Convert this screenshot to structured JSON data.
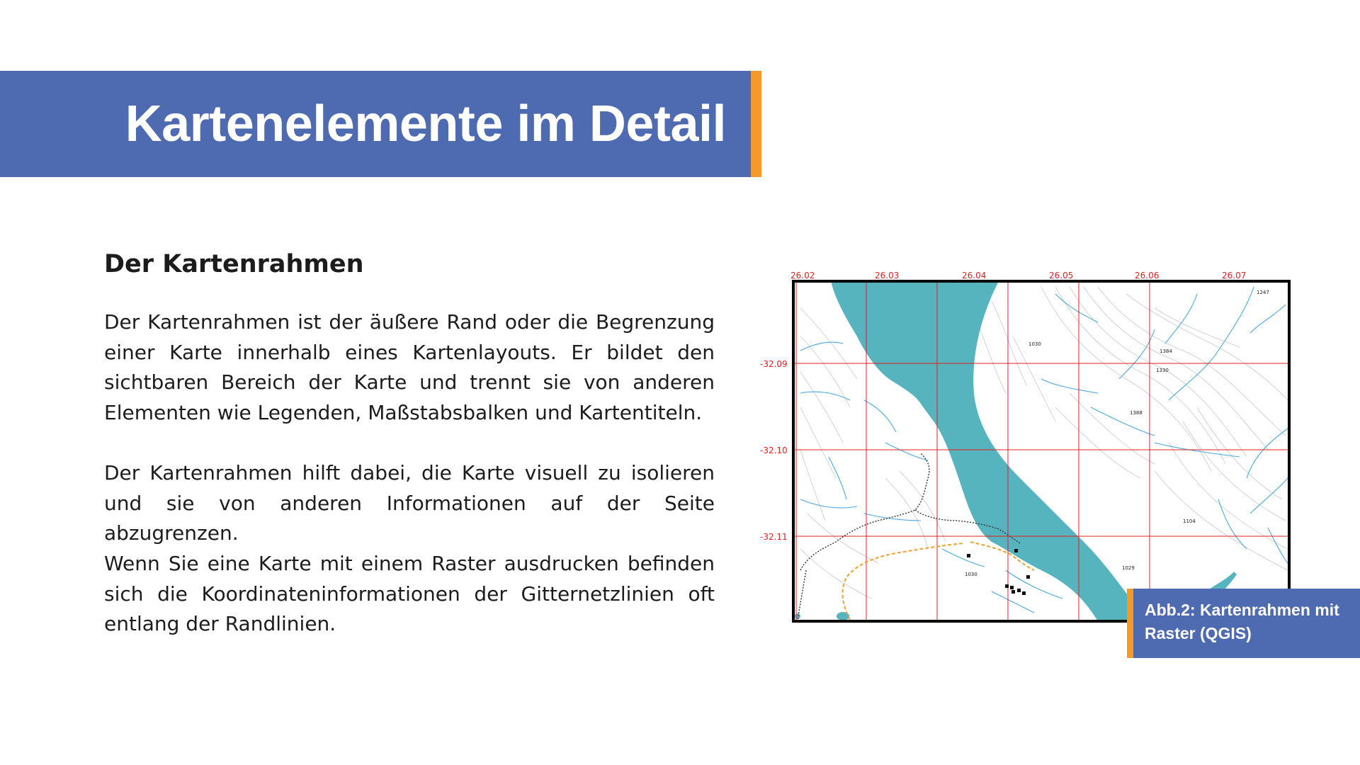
{
  "header": {
    "title": "Kartenelemente im Detail",
    "colors": {
      "bar": "#4e6ab1",
      "accent": "#f39a2a"
    }
  },
  "content": {
    "heading": "Der Kartenrahmen",
    "paragraphs": [
      "Der Kartenrahmen ist der äußere Rand oder die Begrenzung einer Karte innerhalb eines Kartenlayouts. Er bildet den sichtbaren Bereich der Karte und trennt sie von anderen Elementen wie Legenden, Maßstabsbalken und Kartentiteln.",
      "Der Kartenrahmen hilft dabei, die Karte visuell zu isolieren und sie von anderen Informationen auf der Seite abzugrenzen.",
      "Wenn Sie eine Karte mit einem Raster ausdrucken befinden sich die Koordinateninformationen der Gitternetzlinien oft entlang der Randlinien."
    ]
  },
  "map": {
    "x_labels": [
      "26.02",
      "26.03",
      "26.04",
      "26.05",
      "26.06",
      "26.07"
    ],
    "y_labels": [
      "-32.09",
      "-32.10",
      "-32.11"
    ],
    "spot_heights": [
      "1247",
      "1030",
      "1384",
      "1330",
      "1388",
      "1104",
      "1030",
      "1029"
    ],
    "colors": {
      "water": "#56b4be",
      "grid": "#e02020",
      "stream": "#4aa8e0",
      "contour": "#bdbdbd",
      "road": "#f0a030"
    }
  },
  "caption": {
    "text": "Abb.2: Kartenrahmen mit Raster (QGIS)"
  }
}
